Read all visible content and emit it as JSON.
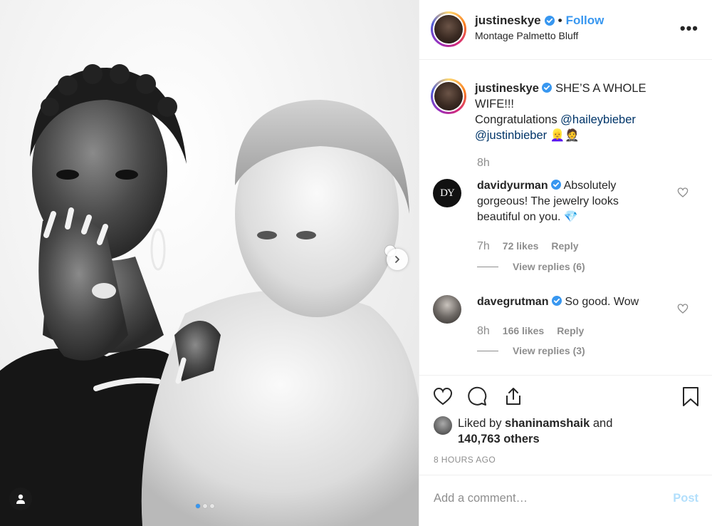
{
  "post": {
    "username": "justineskye",
    "separator": "•",
    "follow_label": "Follow",
    "location": "Montage Palmetto Bluff",
    "more_label": "•••"
  },
  "caption": {
    "username": "justineskye",
    "text_line1": "SHE’S A WHOLE WIFE!!!",
    "text_congrats": "Congratulations ",
    "mention1": "@haileybieber",
    "mention2": "@justinbieber",
    "emojis": "👱‍♀️🤵",
    "time": "8h"
  },
  "comments": [
    {
      "username": "davidyurman",
      "text": "Absolutely gorgeous! The jewelry looks beautiful on you. 💎",
      "time": "7h",
      "likes": "72 likes",
      "reply_label": "Reply",
      "view_replies": "View replies (6)",
      "avatar_monogram": "DY"
    },
    {
      "username": "davegrutman",
      "text": "So good. Wow",
      "time": "8h",
      "likes": "166 likes",
      "reply_label": "Reply",
      "view_replies": "View replies (3)"
    }
  ],
  "likes": {
    "prefix": "Liked by ",
    "liker": "shaninamshaik",
    "middle": " and",
    "others": "140,763 others"
  },
  "timestamp": "8 HOURS AGO",
  "comment_box": {
    "placeholder": "Add a comment…",
    "post_label": "Post"
  },
  "carousel": {
    "total": 3,
    "current": 1
  },
  "colors": {
    "accent": "#3897f0",
    "mention": "#003569",
    "muted": "#8e8e8e",
    "post_disabled": "#b2dffc",
    "text": "#262626"
  }
}
